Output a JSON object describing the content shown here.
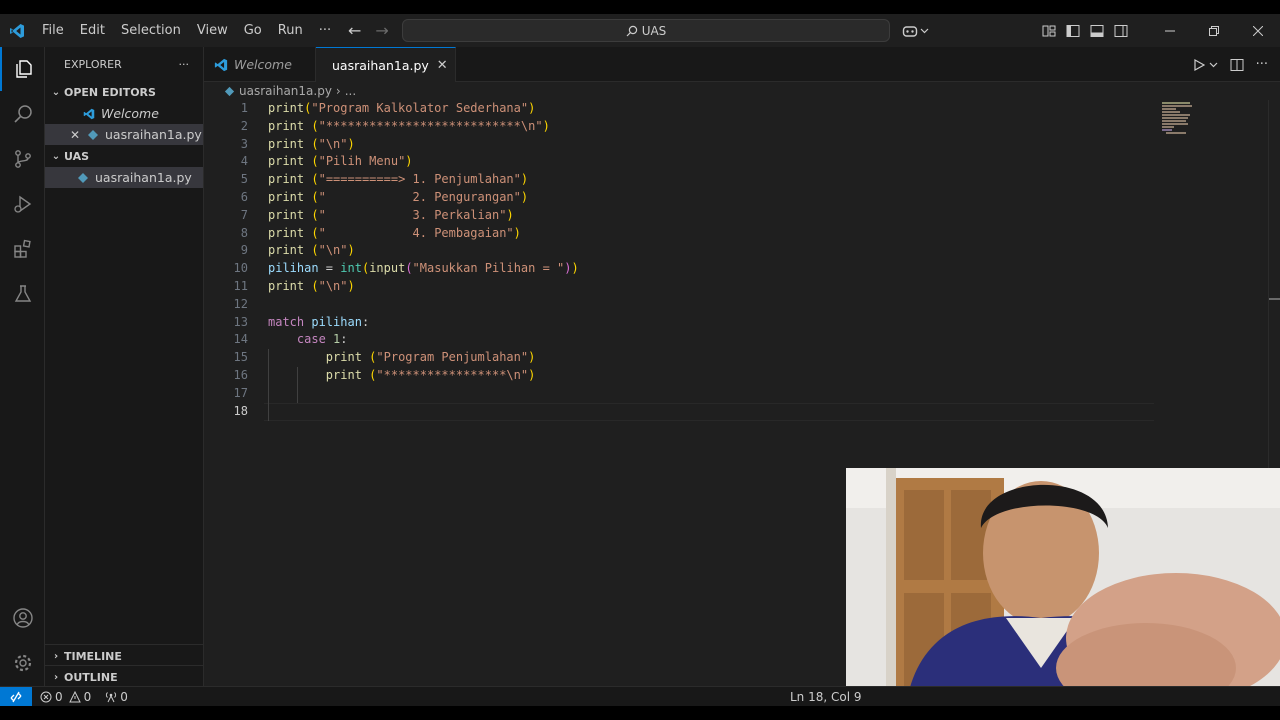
{
  "titlebar": {
    "menu": [
      "File",
      "Edit",
      "Selection",
      "View",
      "Go",
      "Run",
      "···"
    ],
    "search_text": "UAS"
  },
  "sidebar": {
    "title": "EXPLORER",
    "more": "···",
    "open_editors_label": "OPEN EDITORS",
    "open_editors": [
      {
        "name": "Welcome",
        "icon": "vscode-icon"
      },
      {
        "name": "uasraihan1a.py",
        "icon": "python-file-icon",
        "close": "✕"
      }
    ],
    "folder_label": "UAS",
    "files": [
      {
        "name": "uasraihan1a.py",
        "icon": "python-file-icon"
      }
    ],
    "timeline_label": "TIMELINE",
    "outline_label": "OUTLINE"
  },
  "tabs": [
    {
      "label": "Welcome",
      "active": false
    },
    {
      "label": "uasraihan1a.py",
      "active": true,
      "close": "✕"
    }
  ],
  "breadcrumb": {
    "file": "uasraihan1a.py",
    "sep": "›",
    "rest": "..."
  },
  "editor": {
    "current_line": 18,
    "lines": [
      {
        "n": "1",
        "text": "print(\"Program Kalkolator Sederhana\")"
      },
      {
        "n": "2",
        "text": "print (\"***************************\\n\")"
      },
      {
        "n": "3",
        "text": "print (\"\\n\")"
      },
      {
        "n": "4",
        "text": "print (\"Pilih Menu\")"
      },
      {
        "n": "5",
        "text": "print (\"==========> 1. Penjumlahan\")"
      },
      {
        "n": "6",
        "text": "print (\"            2. Pengurangan\")"
      },
      {
        "n": "7",
        "text": "print (\"            3. Perkalian\")"
      },
      {
        "n": "8",
        "text": "print (\"            4. Pembagaian\")"
      },
      {
        "n": "9",
        "text": "print (\"\\n\")"
      },
      {
        "n": "10",
        "text": "pilihan = int(input(\"Masukkan Pilihan = \"))"
      },
      {
        "n": "11",
        "text": "print (\"\\n\")"
      },
      {
        "n": "12",
        "text": ""
      },
      {
        "n": "13",
        "text": "match pilihan:"
      },
      {
        "n": "14",
        "text": "    case 1:"
      },
      {
        "n": "15",
        "text": "        print (\"Program Penjumlahan\")"
      },
      {
        "n": "16",
        "text": "        print (\"*****************\\n\")"
      },
      {
        "n": "17",
        "text": ""
      },
      {
        "n": "18",
        "text": ""
      }
    ]
  },
  "statusbar": {
    "errors": "0",
    "warnings": "0",
    "ports": "0",
    "position": "Ln 18, Col 9"
  },
  "colors": {
    "accent": "#0078d4",
    "editor_bg": "#1f1f1f",
    "sidebar_bg": "#181818",
    "function": "#dcdcaa",
    "string": "#ce9178",
    "keyword": "#c586c0",
    "variable": "#9cdcfe"
  }
}
